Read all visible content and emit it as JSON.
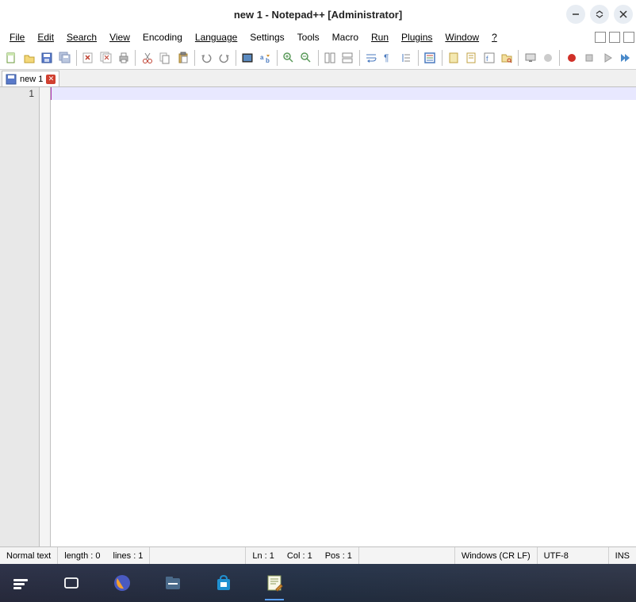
{
  "titlebar": {
    "title": "new 1 - Notepad++ [Administrator]"
  },
  "menu": {
    "file": "File",
    "edit": "Edit",
    "search": "Search",
    "view": "View",
    "encoding": "Encoding",
    "language": "Language",
    "settings": "Settings",
    "tools": "Tools",
    "macro": "Macro",
    "run": "Run",
    "plugins": "Plugins",
    "window": "Window",
    "help": "?"
  },
  "tab": {
    "name": "new 1"
  },
  "editor": {
    "line_number": "1"
  },
  "statusbar": {
    "filetype": "Normal text",
    "length": "length : 0",
    "lines": "lines : 1",
    "ln": "Ln : 1",
    "col": "Col : 1",
    "pos": "Pos : 1",
    "eol": "Windows (CR LF)",
    "encoding": "UTF-8",
    "mode": "INS"
  }
}
